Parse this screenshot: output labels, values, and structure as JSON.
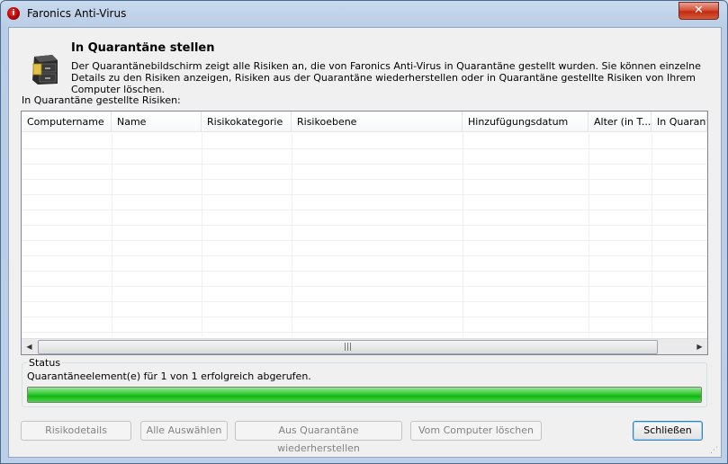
{
  "window": {
    "title": "Faronics Anti-Virus",
    "close_glyph": "✕"
  },
  "header": {
    "title": "In Quarantäne stellen",
    "description": "Der Quarantänebildschirm zeigt alle Risiken an, die von Faronics Anti-Virus in Quarantäne gestellt wurden. Sie können einzelne Details zu den Risiken anzeigen, Risiken aus der Quarantäne wiederherstellen oder in Quarantäne gestellte Risiken von Ihrem Computer löschen.",
    "icon": "file-cabinet-icon"
  },
  "list": {
    "label": "In Quarantäne gestellte Risiken:",
    "columns": [
      "Computername",
      "Name",
      "Risikokategorie",
      "Risikoebene",
      "Hinzufügungsdatum",
      "Alter (in T...",
      "In Quarantä"
    ],
    "rows": []
  },
  "scrollbar": {
    "left_arrow": "◀",
    "right_arrow": "▶",
    "grip": "|||"
  },
  "status": {
    "caption": "Status",
    "text": "Quarantäneelement(e) für 1 von 1 erfolgreich abgerufen.",
    "progress": 1.0,
    "progress_color": "#22c022"
  },
  "buttons": {
    "risk_details": "Risikodetails",
    "select_all": "Alle Auswählen",
    "restore": "Aus Quarantäne wiederherstellen",
    "delete": "Vom Computer löschen",
    "close": "Schließen"
  }
}
